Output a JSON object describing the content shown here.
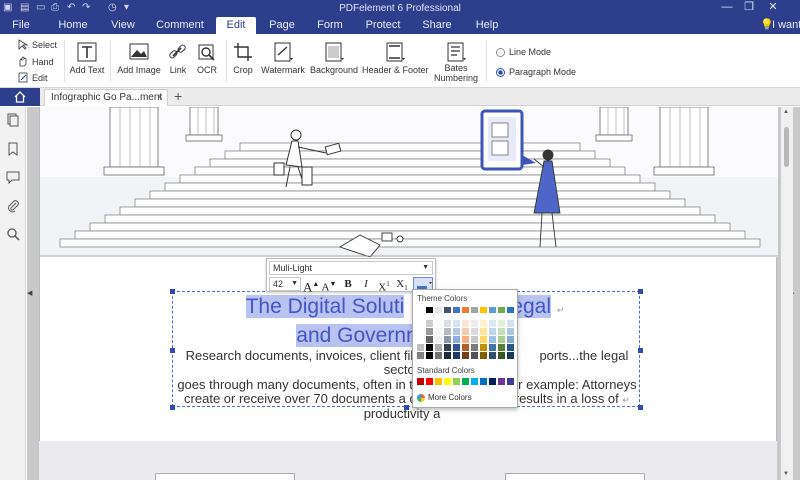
{
  "titlebar": {
    "app_title": "PDFelement 6 Professional",
    "help_search": "I want t",
    "menu": [
      "File",
      "Home",
      "View",
      "Comment",
      "Edit",
      "Page",
      "Form",
      "Protect",
      "Share",
      "Help"
    ],
    "active_menu": "Edit",
    "accent": "#2d3e8c"
  },
  "ribbon": {
    "tools": [
      "Select",
      "Hand",
      "Edit"
    ],
    "buttons": [
      "Add Text",
      "Add Image",
      "Link",
      "OCR",
      "Crop",
      "Watermark",
      "Background",
      "Header & Footer",
      "Bates\nNumbering"
    ],
    "bates_line1": "Bates",
    "bates_line2": "Numbering",
    "modes": [
      "Line Mode",
      "Paragraph Mode"
    ],
    "selected_mode": "Paragraph Mode"
  },
  "tabs": {
    "doc_title": "Infographic Go Pa...ment",
    "close": "×",
    "new_tab": "+"
  },
  "document": {
    "heading_line1": "The Digital Soluti",
    "heading_line1_tail": "egal",
    "heading_line2": "and Governn",
    "body_line1a": "Research documents, invoices, client files, o",
    "body_line1b": "ports...the legal sector",
    "body_line2a": "goes through many documents, often in th",
    "body_line2b": "r example: Attorneys",
    "body_line3a": "create or receive over 70 documents a d",
    "body_line3b": "results in a loss of",
    "body_line4": "productivity a",
    "para_mark": "↵"
  },
  "font_toolbar": {
    "font_name": "Muli-Light",
    "font_size": "42",
    "buttons": [
      "A",
      "A",
      "B",
      "I",
      "X",
      "X"
    ],
    "increase": "A+",
    "decrease": "A-"
  },
  "palette": {
    "theme_title": "Theme Colors",
    "standard_title": "Standard Colors",
    "more_colors": "More Colors",
    "theme_top": [
      "#ffffff",
      "#000000",
      "#e7e6e6",
      "#44546a",
      "#4472c4",
      "#ed7d31",
      "#a5a5a5",
      "#ffc000",
      "#5b9bd5",
      "#70ad47",
      "#2e75b6"
    ],
    "standard": [
      "#c00000",
      "#ff0000",
      "#ffc000",
      "#ffff00",
      "#92d050",
      "#00b050",
      "#00b0f0",
      "#0070c0",
      "#002060",
      "#7030a0",
      "#3b3b98"
    ]
  }
}
